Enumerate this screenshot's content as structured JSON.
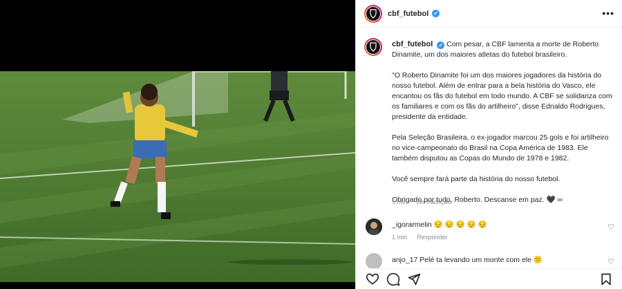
{
  "post": {
    "username": "cbf_futebol",
    "verified_mark": "✓",
    "more_icon": "•••"
  },
  "caption": {
    "username": "cbf_futebol",
    "p1": "Com pesar, a CBF lamenta a morte de Roberto Dinamite, um dos maiores atletas do futebol brasileiro.",
    "p2": "\"O Roberto Dinamite foi um dos maiores jogadores da história do nosso futebol. Além de entrar para a bela história do Vasco, ele encantou os fãs do futebol em todo mundo. A CBF se solidariza com os familiares e com os fãs do artilheiro\", disse Ednaldo Rodrigues, presidente da entidade.",
    "p3": "Pela Seleção Brasileira, o ex-jogador marcou 25 gols e foi artilheiro no vice-campeonato do Brasil na Copa América de 1983. Ele também disputou as Copas do Mundo de 1978 e 1982.",
    "p4": "Você sempre fará parte da história do nosso futebol.",
    "p5": "Obrigado por tudo, Roberto. Descanse em paz. 🖤 ∞",
    "time": "5 min",
    "translate": "Ver tradução"
  },
  "comments": [
    {
      "username": "_igorarmelin",
      "text": "😔 😔 😔 😔 😔",
      "time": "1 min",
      "reply": "Responder"
    },
    {
      "username": "anjo_17",
      "text": "Pelé ta levando um monte com ele 😕"
    }
  ],
  "icons": {
    "heart": "heart-icon",
    "comment": "comment-icon",
    "share": "share-icon",
    "save": "bookmark-icon"
  }
}
